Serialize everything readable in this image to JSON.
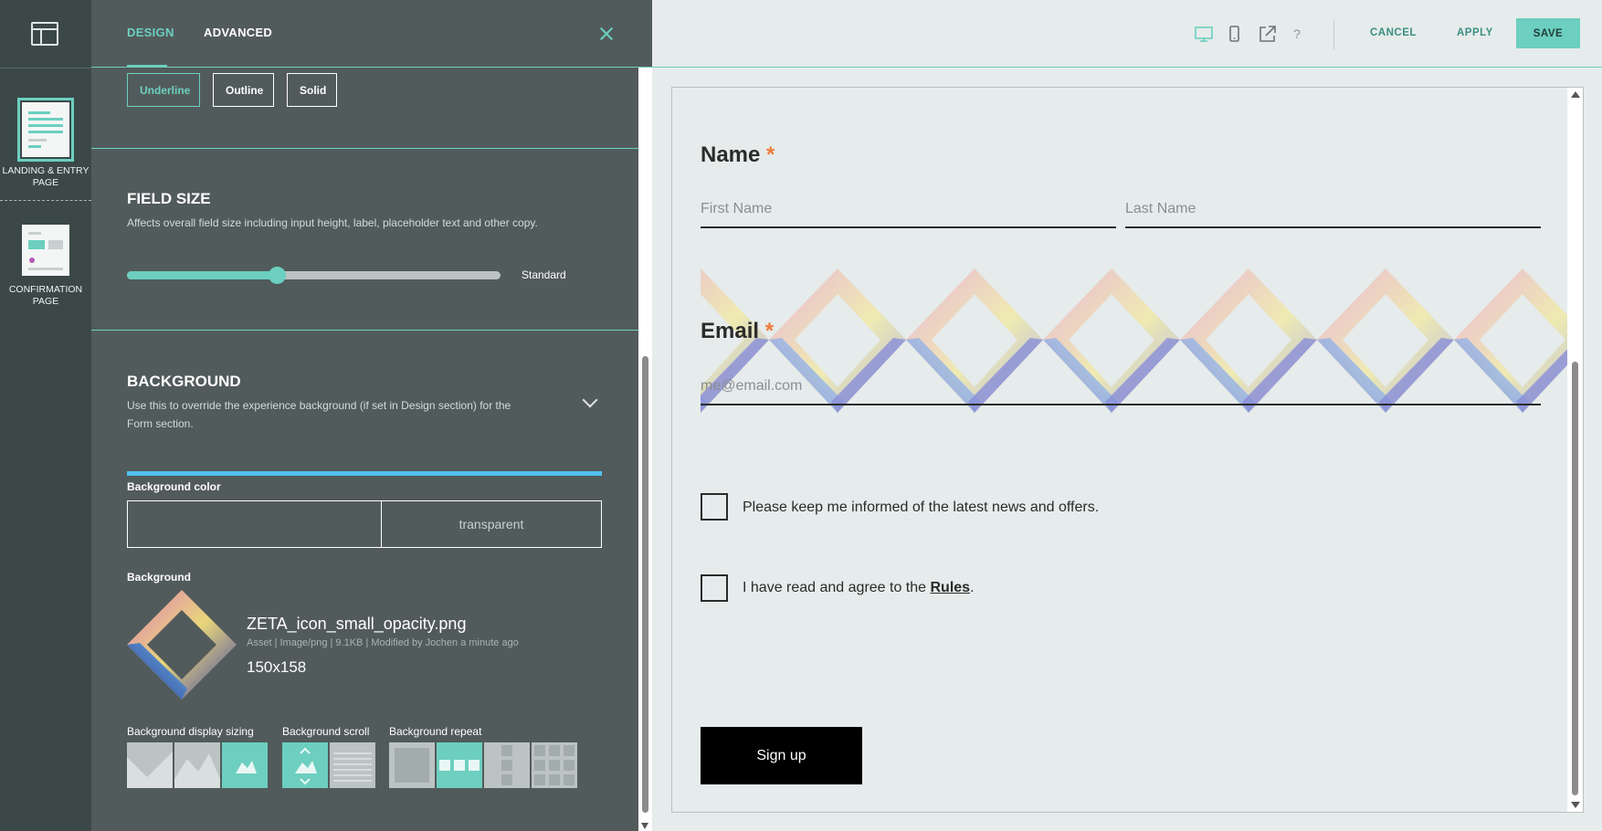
{
  "rail": {
    "pages": [
      {
        "label": "LANDING & ENTRY PAGE",
        "active": true
      },
      {
        "label": "CONFIRMATION PAGE",
        "active": false
      }
    ]
  },
  "panel": {
    "tabs": [
      {
        "label": "DESIGN",
        "active": true
      },
      {
        "label": "ADVANCED",
        "active": false
      }
    ],
    "field_style": {
      "options": [
        "Underline",
        "Outline",
        "Solid"
      ],
      "selected": "Underline"
    },
    "field_size": {
      "title": "FIELD SIZE",
      "description": "Affects overall field size including input height, label, placeholder text and other copy.",
      "slider_fraction": 0.4,
      "value_label": "Standard"
    },
    "background": {
      "title": "BACKGROUND",
      "description": "Use this to override the experience background (if set in Design section) for the Form section.",
      "color_label": "Background color",
      "color_value": "transparent",
      "image_label": "Background",
      "asset": {
        "name": "ZETA_icon_small_opacity.png",
        "meta": "Asset | Image/png | 9.1KB | Modified by Jochen a minute ago",
        "dimensions": "150x158"
      },
      "sizing_label": "Background display sizing",
      "scroll_label": "Background scroll",
      "repeat_label": "Background repeat",
      "sizing_selected": 2,
      "scroll_selected": 0,
      "repeat_selected": 1
    }
  },
  "toolbar": {
    "icons": [
      "desktop-icon",
      "mobile-icon",
      "external-link-icon",
      "help-icon"
    ],
    "cancel": "CANCEL",
    "apply": "APPLY",
    "save": "SAVE"
  },
  "preview": {
    "name_label": "Name",
    "required_mark": "*",
    "first_name_placeholder": "First Name",
    "last_name_placeholder": "Last Name",
    "email_label": "Email",
    "email_placeholder": "me@email.com",
    "checkbox_news": "Please keep me informed of the latest news and offers.",
    "checkbox_rules_prefix": "I have read and agree to the ",
    "checkbox_rules_link": "Rules",
    "checkbox_rules_suffix": ".",
    "signup": "Sign up"
  },
  "colors": {
    "accent": "#6ccfbf",
    "panel_bg": "#525b5b",
    "rail_bg": "#3c4848",
    "required": "#f07b3c",
    "blue_bar": "#52c2f0"
  }
}
